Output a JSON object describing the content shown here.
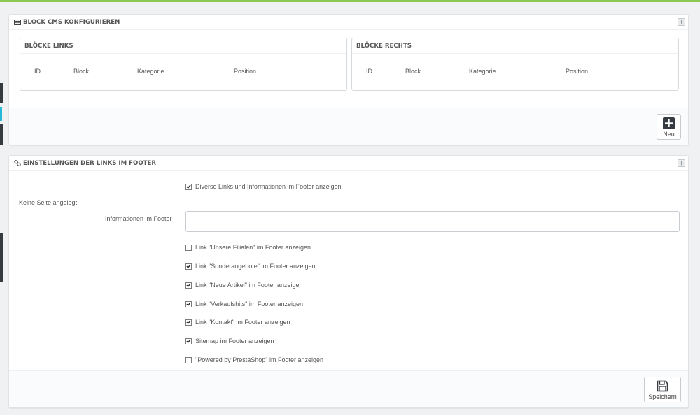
{
  "block_cms": {
    "title": "BLOCK CMS KONFIGURIEREN",
    "left": {
      "title": "BLÖCKE LINKS",
      "columns": [
        "ID",
        "Block",
        "Kategorie",
        "Position"
      ]
    },
    "right": {
      "title": "BLÖCKE RECHTS",
      "columns": [
        "ID",
        "Block",
        "Kategorie",
        "Position"
      ]
    },
    "new_button": "Neu"
  },
  "footer_links": {
    "title": "EINSTELLUNGEN DER LINKS IM FOOTER",
    "no_page": "Keine Seite angelegt",
    "info_label": "Informationen im Footer",
    "info_value": "",
    "checkboxes": [
      {
        "label": "Diverse Links und Informationen im Footer anzeigen",
        "checked": true
      },
      {
        "label": "Link \"Unsere Filialen\" im Footer anzeigen",
        "checked": false
      },
      {
        "label": "Link \"Sonderangebote\" im Footer anzeigen",
        "checked": true
      },
      {
        "label": "Link \"Neue Artikel\" im Footer anzeigen",
        "checked": true
      },
      {
        "label": "Link \"Verkaufshits\" im Footer anzeigen",
        "checked": true
      },
      {
        "label": "Link \"Kontakt\" im Footer anzeigen",
        "checked": true
      },
      {
        "label": "Sitemap im Footer anzeigen",
        "checked": true
      },
      {
        "label": "\"Powered by PrestaShop\" im Footer anzeigen",
        "checked": false
      }
    ],
    "save_button": "Speichern"
  },
  "colors": {
    "accent_green": "#8bc954",
    "table_border": "#a8d6e6",
    "sidebar_active": "#25b9d7"
  }
}
